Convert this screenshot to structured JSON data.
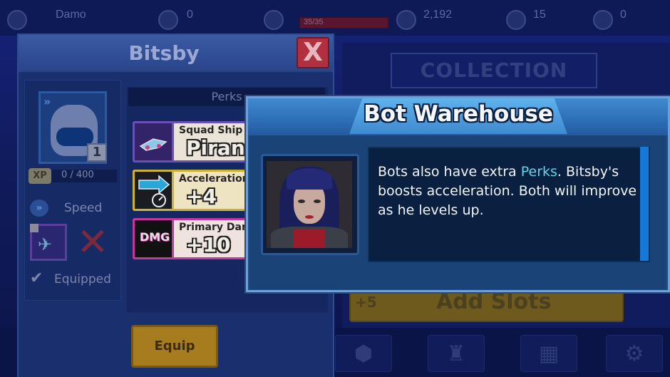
{
  "topbar": {
    "player_name": "Damo",
    "trophies": "0",
    "hp": "35/35",
    "gems": "2,192",
    "tokens": "15",
    "tickets": "0"
  },
  "collection": {
    "title": "COLLECTION",
    "add_slots_prefix": "+5",
    "add_slots_label": "Add Slots"
  },
  "bot_panel": {
    "title": "Bitsby",
    "close_label": "X",
    "level": "1",
    "xp_label": "XP",
    "xp_value": "0 / 400",
    "stat_label": "Speed",
    "equipped_label": "Equipped",
    "perks_header": "Perks",
    "perks": [
      {
        "title": "Squad Ship",
        "value": "Piranha"
      },
      {
        "title": "Acceleration",
        "value": "+4"
      },
      {
        "title": "Primary Dar",
        "value": "+10",
        "icon_text": "DMG"
      }
    ],
    "equip_label": "Equip"
  },
  "popup": {
    "title": "Bot Warehouse",
    "message_pre": "Bots also have extra ",
    "message_highlight": "Perks",
    "message_post": ". Bitsby's boosts acceleration. Both will improve as he levels up.",
    "highlight_color": "#5ed6e8"
  },
  "icons": {
    "close": "close-icon",
    "chevron": "double-chevron-icon",
    "check": "check-icon",
    "ship": "ship-icon"
  }
}
